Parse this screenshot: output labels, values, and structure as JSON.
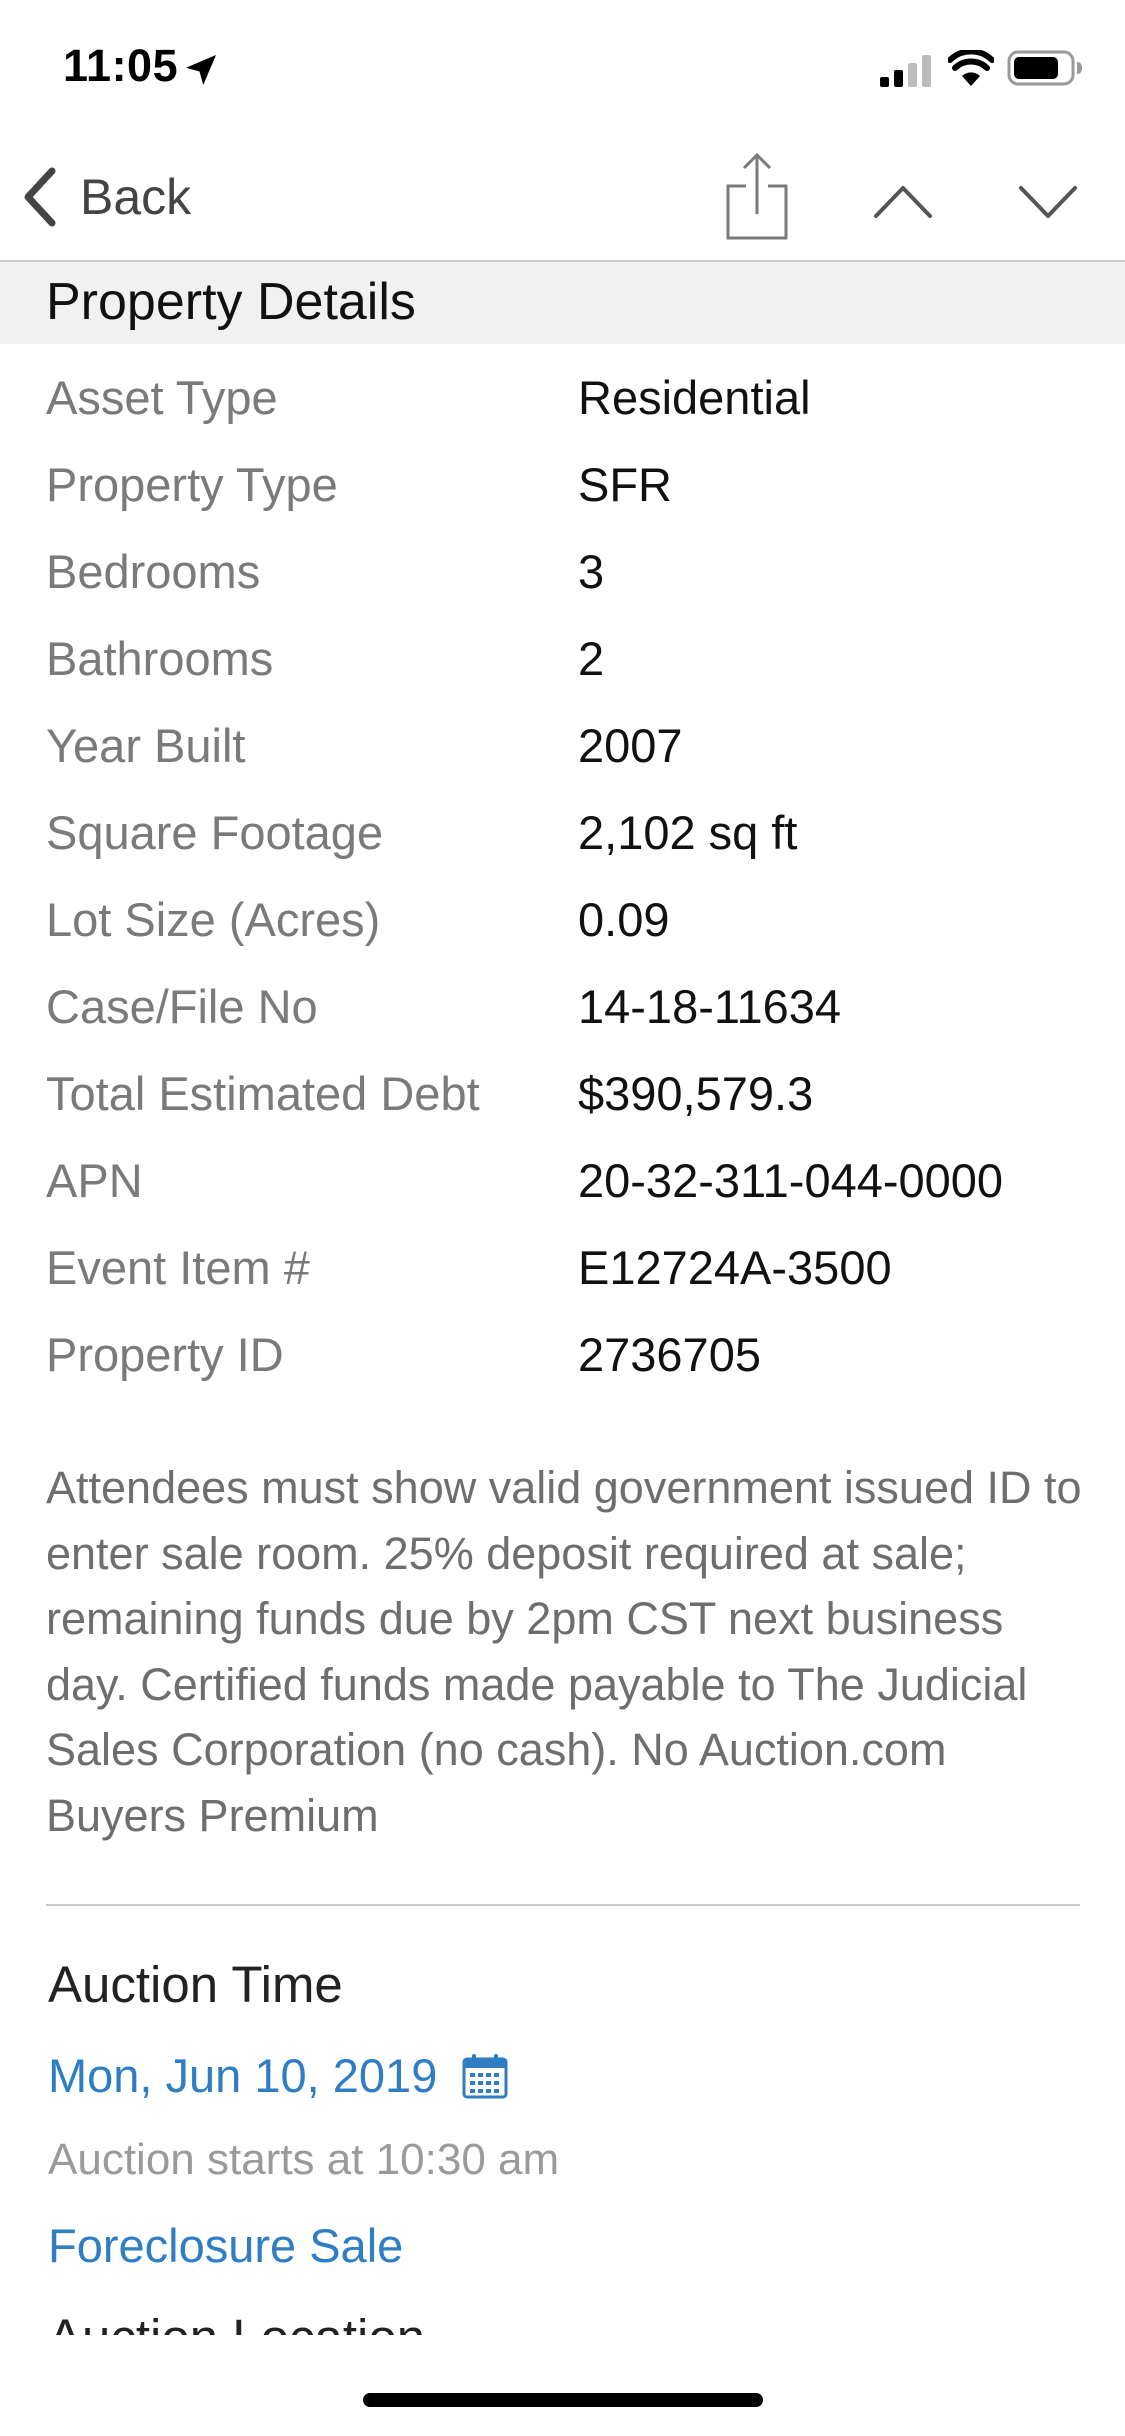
{
  "status_bar": {
    "time": "11:05"
  },
  "nav": {
    "back_label": "Back"
  },
  "property_details": {
    "title": "Property Details",
    "rows": [
      {
        "label": "Asset Type",
        "value": "Residential"
      },
      {
        "label": "Property Type",
        "value": "SFR"
      },
      {
        "label": "Bedrooms",
        "value": "3"
      },
      {
        "label": "Bathrooms",
        "value": "2"
      },
      {
        "label": "Year Built",
        "value": "2007"
      },
      {
        "label": "Square Footage",
        "value": "2,102 sq ft"
      },
      {
        "label": "Lot Size (Acres)",
        "value": "0.09"
      },
      {
        "label": "Case/File No",
        "value": "14-18-11634"
      },
      {
        "label": "Total Estimated Debt",
        "value": "$390,579.3"
      },
      {
        "label": "APN",
        "value": "20-32-311-044-0000"
      },
      {
        "label": "Event Item #",
        "value": "E12724A-3500"
      },
      {
        "label": "Property ID",
        "value": "2736705"
      }
    ],
    "disclaimer": "Attendees must show valid government issued ID to enter sale room. 25% deposit required at sale; remaining funds due by 2pm CST next business day. Certified funds made payable to The Judicial Sales Corporation (no cash). No Auction.com Buyers Premium"
  },
  "auction": {
    "time_title": "Auction Time",
    "date": "Mon, Jun 10, 2019",
    "starts": "Auction starts at 10:30 am",
    "sale_type": "Foreclosure Sale",
    "location_title": "Auction Location"
  },
  "colors": {
    "link_blue": "#2f7ec4",
    "label_gray": "#7a7a7a",
    "header_bg": "#f1f1f1"
  },
  "icons": {
    "location": "location-arrow-icon",
    "signal": "cellular-signal-icon",
    "wifi": "wifi-icon",
    "battery": "battery-icon",
    "back": "chevron-left-icon",
    "share": "share-icon",
    "previous": "chevron-up-icon",
    "next": "chevron-down-icon",
    "calendar": "calendar-icon"
  }
}
